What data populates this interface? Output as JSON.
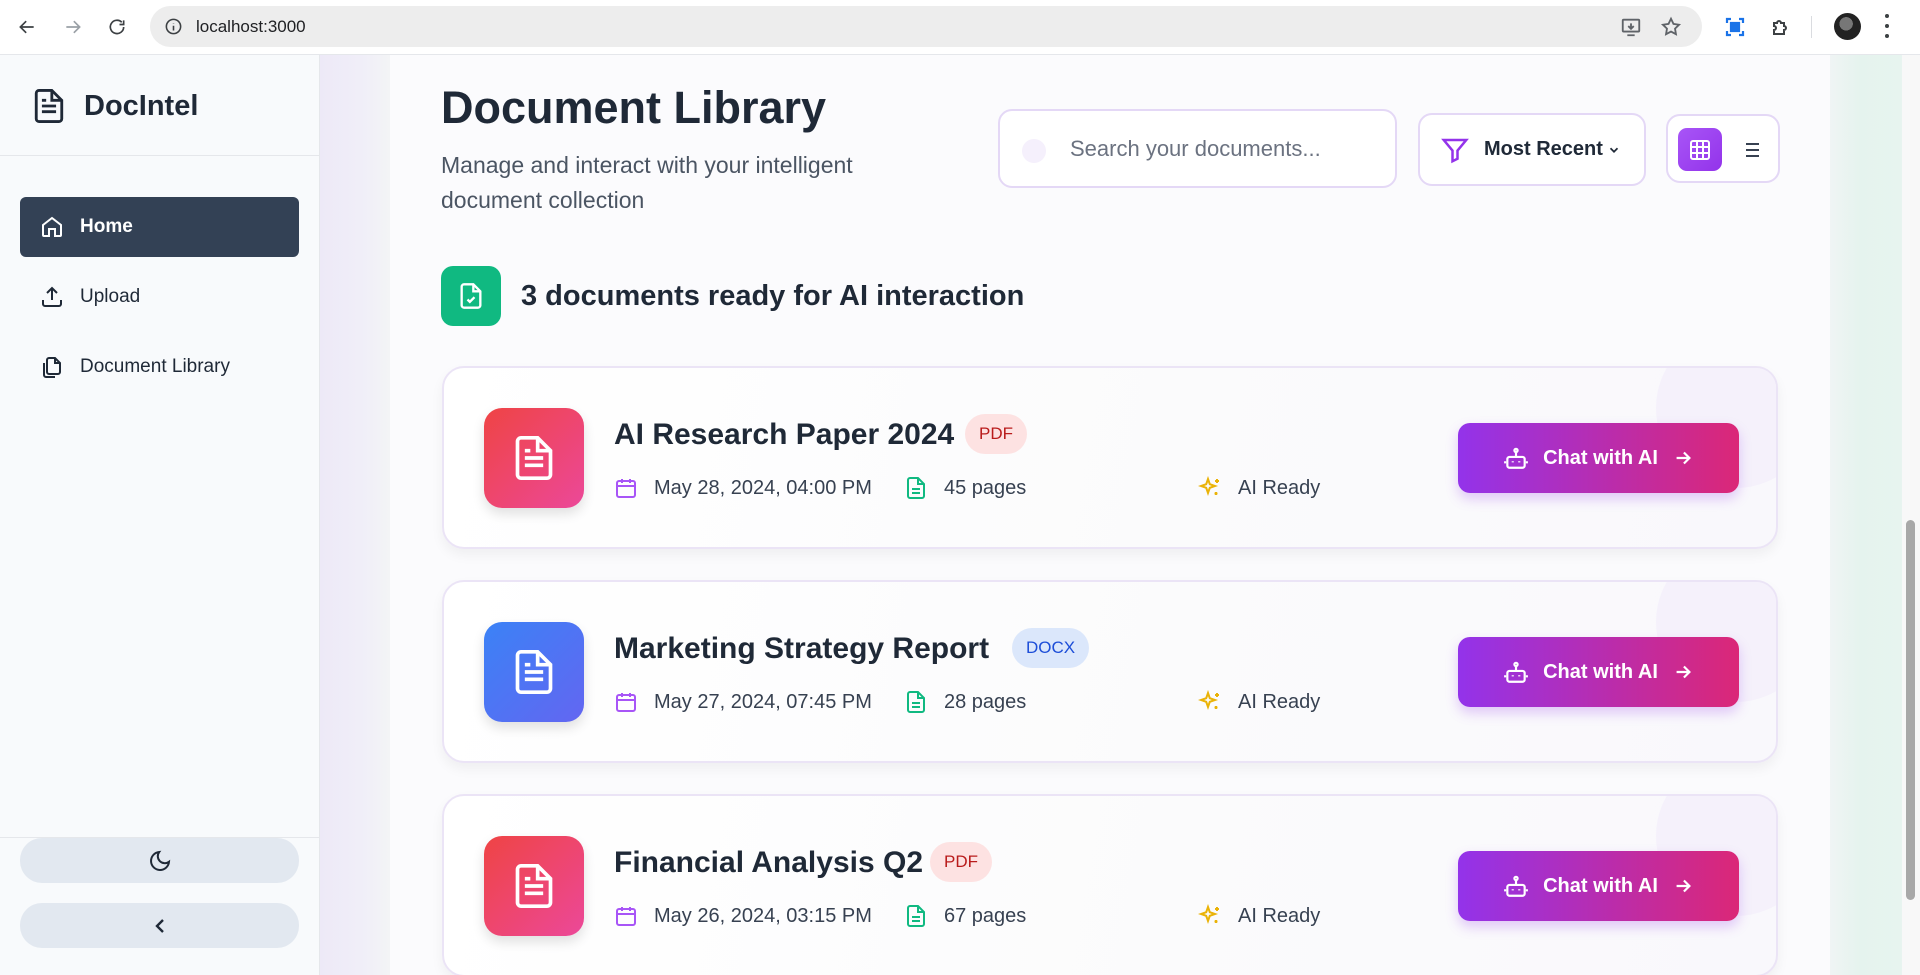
{
  "browser": {
    "url": "localhost:3000"
  },
  "sidebar": {
    "brand": "DocIntel",
    "items": [
      {
        "label": "Home",
        "icon": "home-icon"
      },
      {
        "label": "Upload",
        "icon": "upload-icon"
      },
      {
        "label": "Document Library",
        "icon": "documents-icon"
      }
    ]
  },
  "header": {
    "title": "Document Library",
    "subtitle": "Manage and interact with your intelligent document collection",
    "search_placeholder": "Search your documents...",
    "sort_label": "Most Recent"
  },
  "summary": {
    "text": "3 documents ready for AI interaction"
  },
  "documents": [
    {
      "title": "AI Research Paper 2024",
      "type": "PDF",
      "date": "May 28, 2024, 04:00 PM",
      "pages": "45 pages",
      "status": "AI Ready",
      "action": "Chat with AI"
    },
    {
      "title": "Marketing Strategy Report",
      "type": "DOCX",
      "date": "May 27, 2024, 07:45 PM",
      "pages": "28 pages",
      "status": "AI Ready",
      "action": "Chat with AI"
    },
    {
      "title": "Financial Analysis Q2",
      "type": "PDF",
      "date": "May 26, 2024, 03:15 PM",
      "pages": "67 pages",
      "status": "AI Ready",
      "action": "Chat with AI"
    }
  ],
  "colors": {
    "sidebar_active": "#334155",
    "accent_purple": "#9333ea",
    "accent_pink": "#db2777",
    "success_green": "#10b981",
    "pdf_icon": "#ef4444",
    "docx_icon": "#3b82f6"
  }
}
